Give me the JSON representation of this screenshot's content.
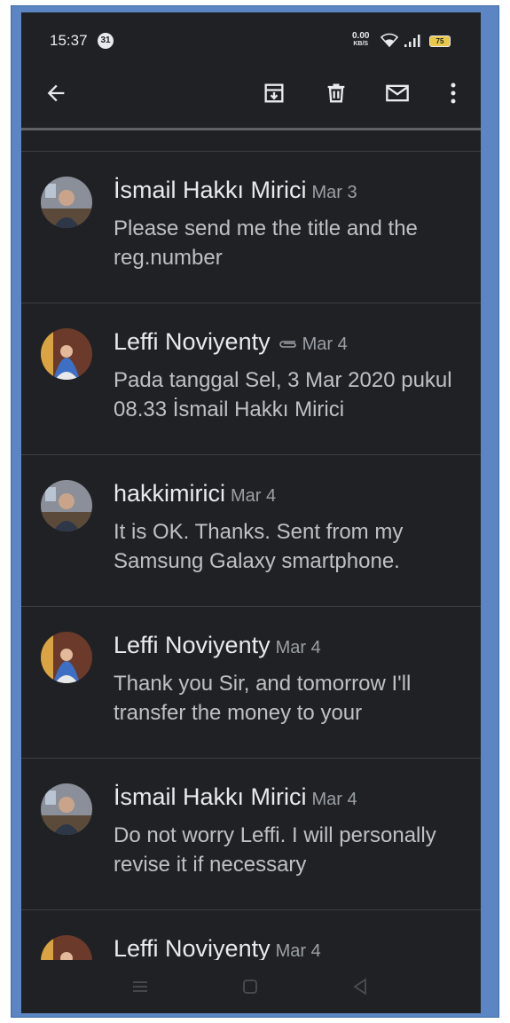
{
  "status_bar": {
    "time": "15:37",
    "notification_count": "31",
    "net_speed": "0.00",
    "net_unit": "KB/S",
    "battery": "75"
  },
  "toolbar": {
    "icons": [
      "back-arrow-icon",
      "archive-icon",
      "delete-icon",
      "mark-unread-icon",
      "more-vert-icon"
    ]
  },
  "messages": [
    {
      "sender": "İsmail Hakkı Mirici",
      "date": "Mar 3",
      "snippet": "Please send me the title and the reg.number",
      "avatar": "man",
      "attachment": false
    },
    {
      "sender": "Leffi Noviyenty",
      "date": "Mar 4",
      "snippet": "Pada tanggal Sel, 3 Mar 2020 pukul 08.33 İsmail Hakkı Mirici",
      "avatar": "woman",
      "attachment": true
    },
    {
      "sender": "hakkimirici",
      "date": "Mar 4",
      "snippet": "It is OK. Thanks. Sent from my Samsung Galaxy smartphone.",
      "avatar": "man",
      "attachment": false
    },
    {
      "sender": "Leffi Noviyenty",
      "date": "Mar 4",
      "snippet": "Thank you Sir, and tomorrow I'll transfer the money to your",
      "avatar": "woman",
      "attachment": false
    },
    {
      "sender": "İsmail Hakkı Mirici",
      "date": "Mar 4",
      "snippet": "Do not worry Leffi. I will personally revise it if necessary",
      "avatar": "man",
      "attachment": false
    },
    {
      "sender": "Leffi Noviyenty",
      "date": "Mar 4",
      "snippet": "",
      "avatar": "woman",
      "attachment": false
    }
  ],
  "colors": {
    "background": "#202124",
    "frame": "#5b86c3",
    "primary_text": "#e8eaed",
    "secondary_text": "#9aa0a6"
  }
}
